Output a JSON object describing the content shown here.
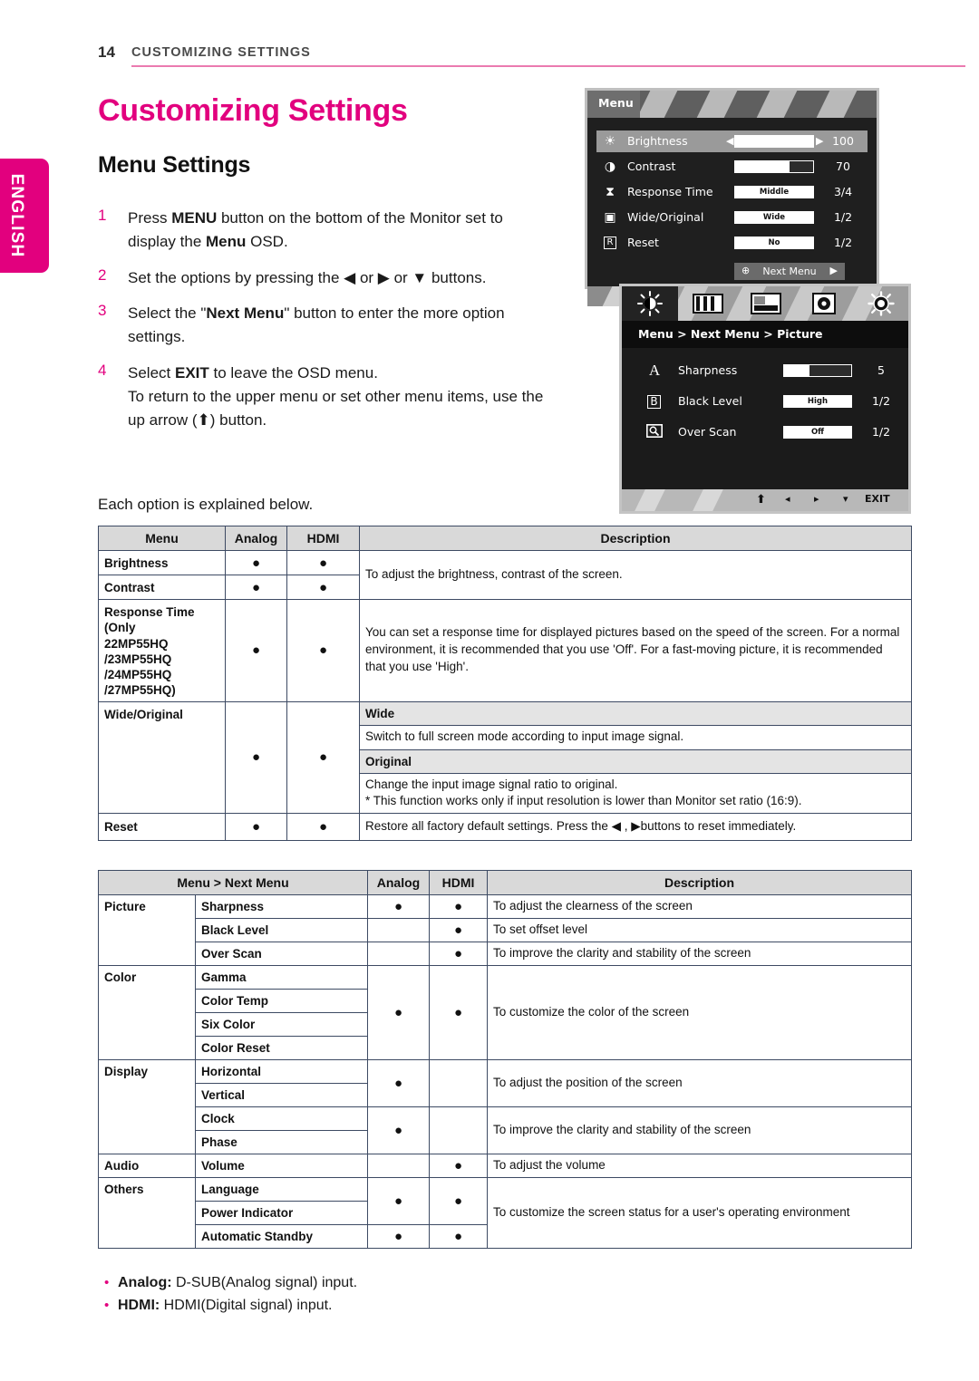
{
  "header": {
    "page_number": "14",
    "title": "CUSTOMIZING SETTINGS",
    "rule_color": "#eb7bb0"
  },
  "language_tab": {
    "label": "ENGLISH",
    "color": "#e2007e"
  },
  "titles": {
    "h1": "Customizing Settings",
    "h2": "Menu Settings",
    "h1_color": "#e2007e"
  },
  "steps": [
    {
      "num": "1",
      "html": "Press <b>MENU</b> button on the bottom of the Monitor set to display the <b>Menu</b> OSD."
    },
    {
      "num": "2",
      "html": "Set the options by pressing the ◀ or ▶ or ▼ buttons."
    },
    {
      "num": "3",
      "html": "Select the \"<b>Next Menu</b>\" button to enter the more option settings."
    },
    {
      "num": "4",
      "html": "Select <b>EXIT</b> to leave the OSD menu.<br>To return to the upper menu or set other menu items, use the up arrow (⬆) button."
    }
  ],
  "each_option_note": "Each option is explained below.",
  "osd_menu": {
    "tab_label": "Menu",
    "rows": [
      {
        "icon": "brightness-sun-icon",
        "glyph": "☀",
        "label": "Brightness",
        "control": "slider",
        "fill": 100,
        "value": "100",
        "selected": true,
        "arrows": true
      },
      {
        "icon": "contrast-circle-icon",
        "glyph": "◑",
        "label": "Contrast",
        "control": "slider",
        "fill": 70,
        "value": "70",
        "selected": false,
        "arrows": false
      },
      {
        "icon": "hourglass-icon",
        "glyph": "⧗",
        "label": "Response Time",
        "control": "text",
        "text": "Middle",
        "value": "3/4",
        "selected": false,
        "arrows": false
      },
      {
        "icon": "wide-screen-icon",
        "glyph": "▣",
        "label": "Wide/Original",
        "control": "text",
        "text": "Wide",
        "value": "1/2",
        "selected": false,
        "arrows": false
      },
      {
        "icon": "reset-r-icon",
        "glyph": "R",
        "label": "Reset",
        "control": "text",
        "text": "No",
        "value": "1/2",
        "selected": false,
        "arrows": false
      }
    ],
    "next_menu_label": "Next Menu",
    "next_menu_plus": "⊕",
    "next_menu_arrow": "▶"
  },
  "osd_picture": {
    "tabs": [
      {
        "name": "picture-tab-icon",
        "active": true
      },
      {
        "name": "color-tab-icon",
        "active": false
      },
      {
        "name": "display-tab-icon",
        "active": false
      },
      {
        "name": "audio-tab-icon",
        "active": false
      },
      {
        "name": "others-tab-icon",
        "active": false
      }
    ],
    "breadcrumb": "Menu  >  Next Menu  >  Picture",
    "rows": [
      {
        "icon": "sharpness-a-icon",
        "glyph": "A",
        "label": "Sharpness",
        "control": "slider",
        "fill": 38,
        "value": "5"
      },
      {
        "icon": "black-level-b-icon",
        "glyph": "⊞",
        "label": "Black Level",
        "control": "text",
        "text": "High",
        "value": "1/2"
      },
      {
        "icon": "over-scan-icon",
        "glyph": "⌲",
        "label": "Over Scan",
        "control": "text",
        "text": "Off",
        "value": "1/2"
      }
    ],
    "footer_buttons": [
      {
        "name": "up-arrow-button",
        "glyph": "⬆"
      },
      {
        "name": "left-arrow-button",
        "glyph": "◂"
      },
      {
        "name": "right-arrow-button",
        "glyph": "▸"
      },
      {
        "name": "down-arrow-button",
        "glyph": "▾"
      },
      {
        "name": "exit-button",
        "glyph": "EXIT"
      }
    ]
  },
  "table1": {
    "headers": [
      "Menu",
      "Analog",
      "HDMI",
      "Description"
    ],
    "dot": "●",
    "rows": {
      "brightness": "Brightness",
      "contrast": "Contrast",
      "brightness_contrast_desc": "To adjust the brightness, contrast of the screen.",
      "response_time": "Response Time (Only\n22MP55HQ\n/23MP55HQ\n/24MP55HQ\n/27MP55HQ)",
      "response_time_l1": "Response Time",
      "response_time_l2": "(Only",
      "response_time_l3": "22MP55HQ",
      "response_time_l4": "/23MP55HQ",
      "response_time_l5": "/24MP55HQ",
      "response_time_l6": "/27MP55HQ)",
      "response_time_desc": "You can set a response time for displayed pictures based on the speed of the screen. For a normal environment, it is recommended that you use 'Off'. For a fast-moving picture, it is recommended that you use 'High'.",
      "wide_original": "Wide/Original",
      "wide_sub": "Wide",
      "wide_desc": "Switch to full screen mode according to input image signal.",
      "original_sub": "Original",
      "original_desc_l1": "Change the input image signal ratio to original.",
      "original_desc_l2": "* This function works only if input resolution is lower than Monitor set ratio (16:9).",
      "reset": "Reset",
      "reset_desc": "Restore all factory default settings. Press the ◀ , ▶buttons to reset immediately."
    }
  },
  "table2": {
    "headers": [
      "Menu > Next Menu",
      "Analog",
      "HDMI",
      "Description"
    ],
    "dot": "●",
    "groups": [
      {
        "group": "Picture",
        "items": [
          {
            "name": "Sharpness",
            "analog": true,
            "hdmi": true,
            "desc": "To adjust the clearness of the screen"
          },
          {
            "name": "Black Level",
            "analog": false,
            "hdmi": true,
            "desc": "To set offset level"
          },
          {
            "name": "Over Scan",
            "analog": false,
            "hdmi": true,
            "desc": "To improve the clarity and stability of the screen"
          }
        ]
      },
      {
        "group": "Color",
        "items": [
          {
            "name": "Gamma"
          },
          {
            "name": "Color Temp"
          },
          {
            "name": "Six Color"
          },
          {
            "name": "Color Reset"
          }
        ],
        "analog": true,
        "hdmi": true,
        "desc": "To customize the color of the screen"
      },
      {
        "group": "Display",
        "subgroups": [
          {
            "items": [
              {
                "name": "Horizontal"
              },
              {
                "name": "Vertical"
              }
            ],
            "analog": true,
            "hdmi": false,
            "desc": "To adjust the position of the screen"
          },
          {
            "items": [
              {
                "name": "Clock"
              },
              {
                "name": "Phase"
              }
            ],
            "analog": true,
            "hdmi": false,
            "desc": "To improve the clarity and stability of the screen"
          }
        ]
      },
      {
        "group": "Audio",
        "items": [
          {
            "name": "Volume",
            "analog": false,
            "hdmi": true,
            "desc": "To adjust the volume"
          }
        ]
      },
      {
        "group": "Others",
        "items": [
          {
            "name": "Language"
          },
          {
            "name": "Power Indicator"
          },
          {
            "name": "Automatic Standby"
          }
        ],
        "desc": "To customize the screen status for a user's operating environment"
      }
    ]
  },
  "notes": [
    {
      "bullet": "•",
      "bold": "Analog:",
      "rest": " D-SUB(Analog signal) input."
    },
    {
      "bullet": "•",
      "bold": "HDMI:",
      "rest": " HDMI(Digital signal) input."
    }
  ]
}
